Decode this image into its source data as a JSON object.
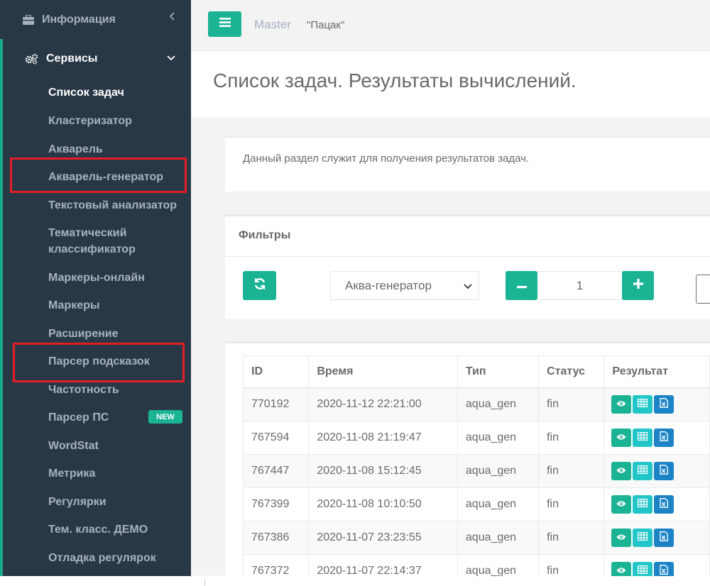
{
  "sidebar": {
    "info_label": "Информация",
    "services_label": "Сервисы",
    "items": [
      {
        "label": "Список задач"
      },
      {
        "label": "Кластеризатор"
      },
      {
        "label": "Акварель"
      },
      {
        "label": "Акварель-генератор"
      },
      {
        "label": "Текстовый анализатор"
      },
      {
        "label": "Тематический"
      },
      {
        "label": "классификатор"
      },
      {
        "label": "Маркеры-онлайн"
      },
      {
        "label": "Маркеры"
      },
      {
        "label": "Расширение"
      },
      {
        "label": "Парсер подсказок"
      },
      {
        "label": "Частотность"
      },
      {
        "label": "Парсер ПС"
      },
      {
        "label": "WordStat"
      },
      {
        "label": "Метрика"
      },
      {
        "label": "Регулярки"
      },
      {
        "label": "Тем. класс. ДЕМО"
      },
      {
        "label": "Отладка регулярок"
      }
    ],
    "new_badge": "NEW",
    "highlight_color": "#e31e24",
    "accent_color": "#1ab394"
  },
  "topbar": {
    "master_label": "Master",
    "user_label": "\"Пацак\""
  },
  "page": {
    "title": "Список задач. Результаты вычислений.",
    "info_text": "Данный раздел служит для получения результатов задач."
  },
  "filters": {
    "title": "Фильтры",
    "type_select": "Аква-генератор",
    "count_value": "1"
  },
  "table": {
    "headers": [
      "ID",
      "Время",
      "Тип",
      "Статус",
      "Результат"
    ],
    "rows": [
      [
        "770192",
        "2020-11-12 22:21:00",
        "aqua_gen",
        "fin"
      ],
      [
        "767594",
        "2020-11-08 21:19:47",
        "aqua_gen",
        "fin"
      ],
      [
        "767447",
        "2020-11-08 15:12:45",
        "aqua_gen",
        "fin"
      ],
      [
        "767399",
        "2020-11-08 10:10:50",
        "aqua_gen",
        "fin"
      ],
      [
        "767386",
        "2020-11-07 23:23:55",
        "aqua_gen",
        "fin"
      ],
      [
        "767372",
        "2020-11-07 22:14:37",
        "aqua_gen",
        "fin"
      ]
    ],
    "result_icons": [
      "eye-icon",
      "table-icon",
      "excel-icon"
    ]
  }
}
